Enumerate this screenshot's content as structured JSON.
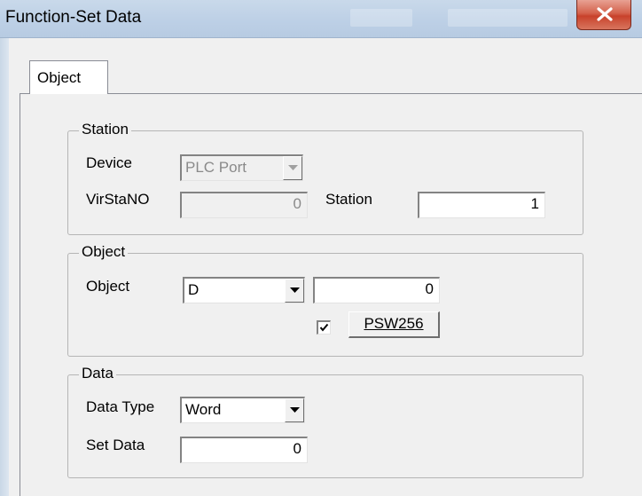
{
  "window": {
    "title": "Function-Set Data"
  },
  "tabs": [
    {
      "label": "Object"
    }
  ],
  "station_group": {
    "legend": "Station",
    "device_label": "Device",
    "device_value": "PLC Port",
    "virstano_label": "VirStaNO",
    "virstano_value": "0",
    "station_label": "Station",
    "station_value": "1"
  },
  "object_group": {
    "legend": "Object",
    "object_label": "Object",
    "object_type_value": "D",
    "object_address_value": "0",
    "psw_checked": true,
    "psw_button_label": "PSW256"
  },
  "data_group": {
    "legend": "Data",
    "data_type_label": "Data Type",
    "data_type_value": "Word",
    "set_data_label": "Set Data",
    "set_data_value": "0"
  },
  "colors": {
    "titlebar": "#bdd0e6",
    "close_button": "#c8422b",
    "dialog_background": "#f0f0f0"
  }
}
